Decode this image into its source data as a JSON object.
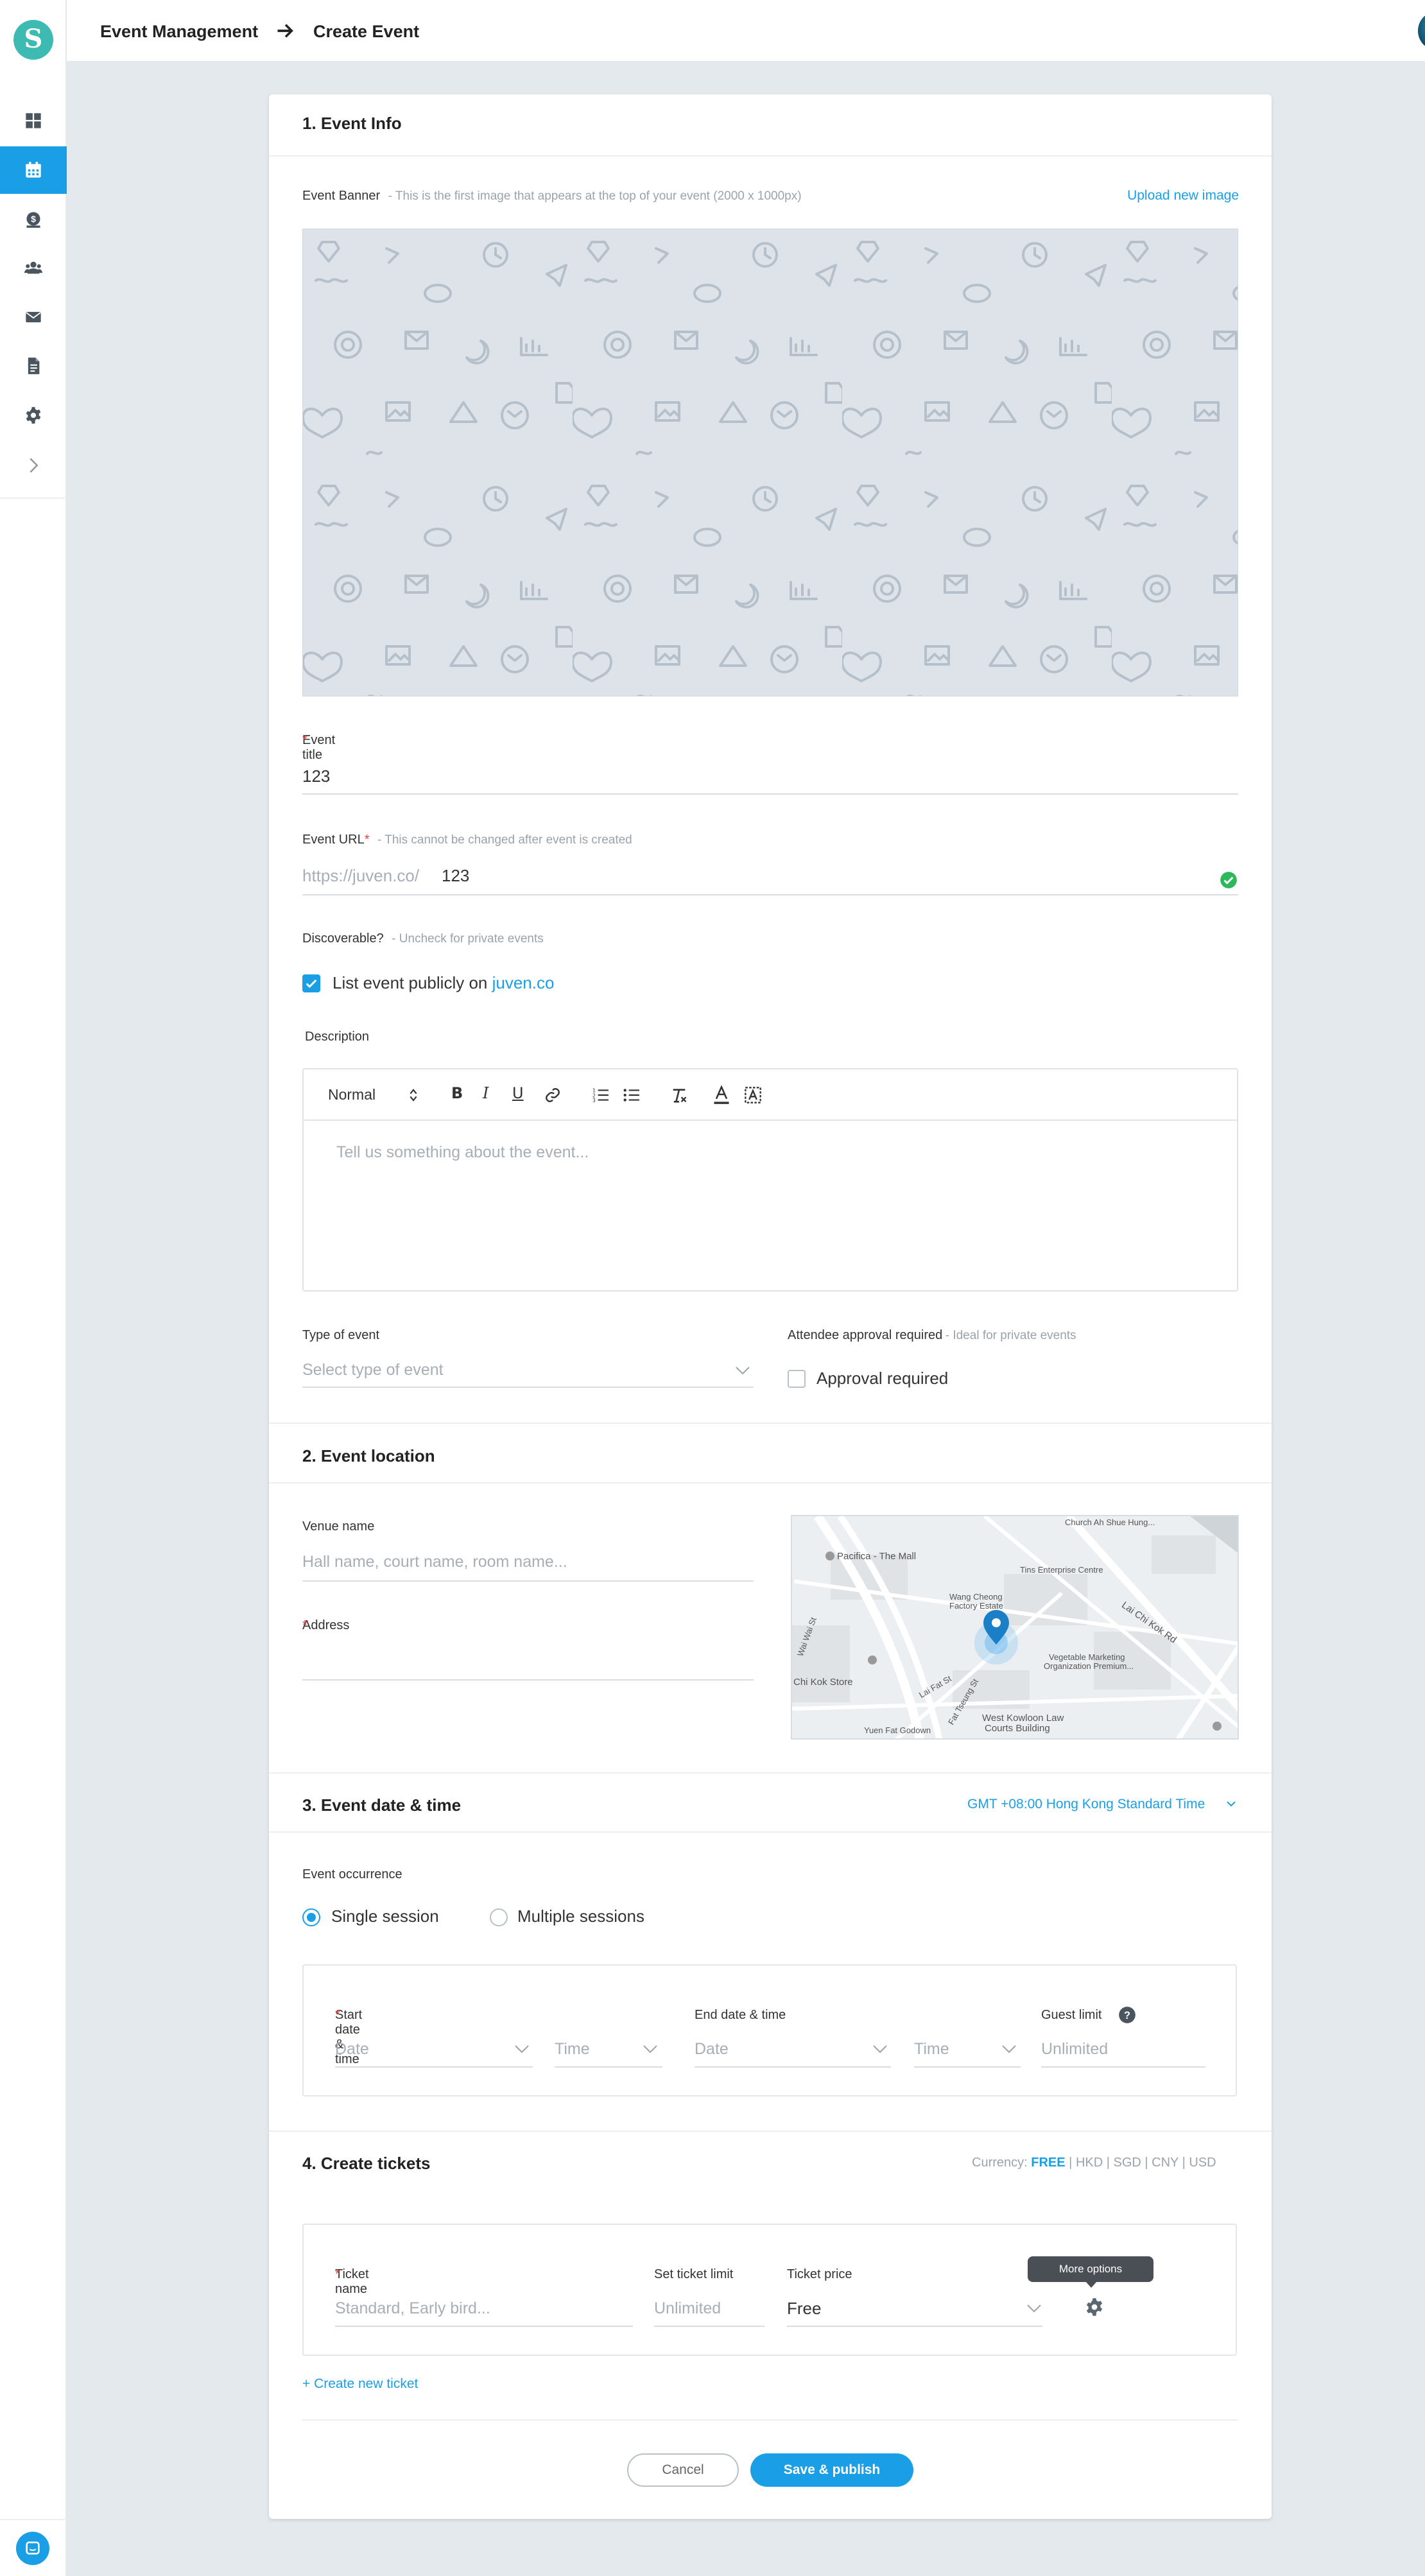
{
  "header": {
    "breadcrumb_parent": "Event Management",
    "breadcrumb_current": "Create Event"
  },
  "sidebar": {
    "logo_letter": "S",
    "items": [
      {
        "icon": "dashboard-icon",
        "active": false
      },
      {
        "icon": "calendar-icon",
        "active": true
      },
      {
        "icon": "payments-icon",
        "active": false
      },
      {
        "icon": "users-icon",
        "active": false
      },
      {
        "icon": "mail-icon",
        "active": false
      },
      {
        "icon": "document-icon",
        "active": false
      },
      {
        "icon": "gear-icon",
        "active": false
      },
      {
        "icon": "chevron-right-icon",
        "active": false
      }
    ],
    "accent": "#1a9fe6"
  },
  "event_info": {
    "title": "1. Event Info",
    "banner_label": "Event Banner",
    "banner_note": "- This is the first image that appears at the top of your event (2000 x 1000px)",
    "upload_link": "Upload new image",
    "event_title_label": "Event title",
    "required_mark": "*",
    "event_title_value": "123",
    "event_url_label": "Event URL",
    "event_url_note": "- This cannot be changed after event is created",
    "url_prefix": "https://juven.co/",
    "url_value": "123",
    "discoverable_label": "Discoverable?",
    "discoverable_note": "- Uncheck for private events",
    "list_publicly_text": "List event publicly on",
    "list_publicly_link": "juven.co",
    "description_label": "Description",
    "format_select": "Normal",
    "description_placeholder": "Tell us something about the event...",
    "type_label": "Type of event",
    "type_placeholder": "Select type of event",
    "approval_label": "Attendee approval required",
    "approval_note": "- Ideal for private events",
    "approval_checkbox": "Approval required"
  },
  "location": {
    "title": "2. Event location",
    "venue_label": "Venue name",
    "venue_placeholder": "Hall name, court name, room name...",
    "address_label": "Address",
    "map_labels": {
      "pacifica": "Pacifica - The Mall",
      "church": "Church Ah Shue Hung...",
      "tins": "Tins Enterprise Centre",
      "wang": "Wang Cheong",
      "factory": "Factory Estate",
      "laichikok": "Lai Chi Kok Rd",
      "veg": "Vegetable Marketing",
      "org": "Organization Premium...",
      "chikok": "Chi Kok Store",
      "westkowloon": "West Kowloon Law",
      "courts": "Courts Building",
      "yuenfat": "Yuen Fat Godown",
      "laifat": "Lai Fat St",
      "faitsueng": "Fat Tseung St",
      "waiwai": "Wai Wai St"
    }
  },
  "datetime": {
    "title": "3. Event date & time",
    "timezone": "GMT +08:00 Hong Kong Standard Time",
    "occurrence_label": "Event occurrence",
    "single": "Single session",
    "multiple": "Multiple sessions",
    "start_label": "Start date & time",
    "end_label": "End date & time",
    "guest_limit_label": "Guest limit",
    "date_placeholder": "Date",
    "time_placeholder": "Time",
    "guest_placeholder": "Unlimited"
  },
  "tickets": {
    "title": "4. Create tickets",
    "currency_label": "Currency:",
    "currencies": [
      "FREE",
      "HKD",
      "SGD",
      "CNY",
      "USD"
    ],
    "currency_sep": "|",
    "ticket_name_label": "Ticket name",
    "ticket_name_placeholder": "Standard, Early bird...",
    "limit_label": "Set ticket limit",
    "limit_placeholder": "Unlimited",
    "price_label": "Ticket price",
    "price_value": "Free",
    "tooltip": "More options",
    "create_new": "+ Create new ticket"
  },
  "actions": {
    "cancel": "Cancel",
    "save": "Save & publish"
  }
}
